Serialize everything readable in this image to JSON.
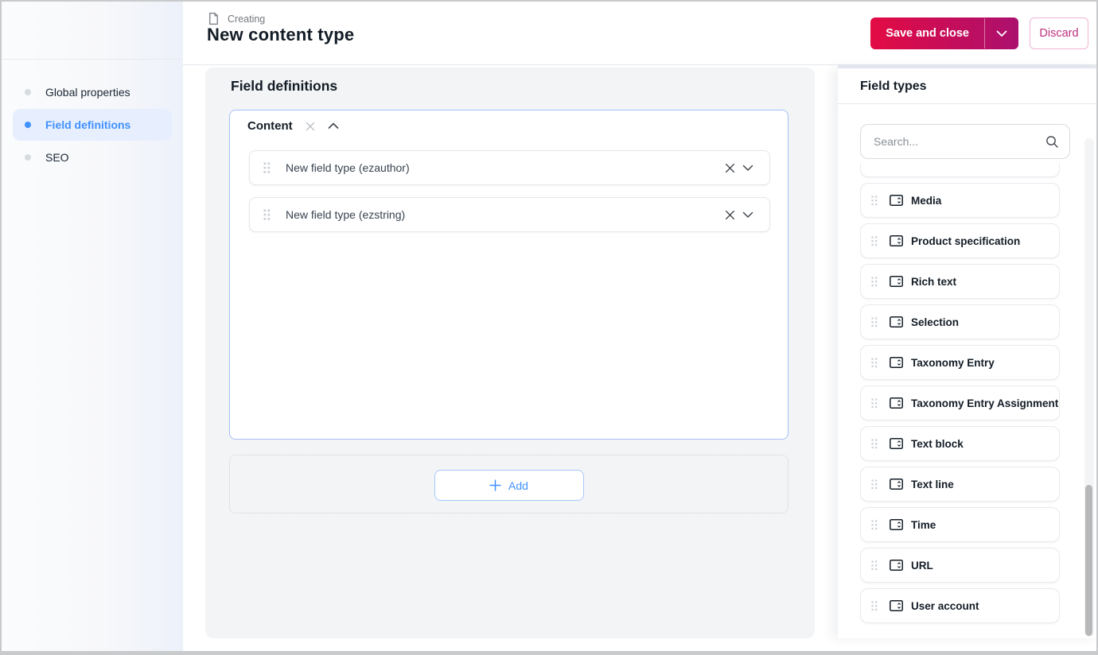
{
  "header": {
    "breadcrumb": "Creating",
    "title": "New content type",
    "save_button": "Save and close",
    "discard_button": "Discard"
  },
  "sidebar": {
    "items": [
      {
        "label": "Global properties",
        "active": false
      },
      {
        "label": "Field definitions",
        "active": true
      },
      {
        "label": "SEO",
        "active": false
      }
    ]
  },
  "main": {
    "heading": "Field definitions",
    "group": {
      "title": "Content",
      "fields": [
        {
          "label": "New field type (ezauthor)"
        },
        {
          "label": "New field type (ezstring)"
        }
      ]
    },
    "add_button": "Add"
  },
  "field_types_panel": {
    "title": "Field types",
    "search_placeholder": "Search...",
    "items": [
      "Media",
      "Product specification",
      "Rich text",
      "Selection",
      "Taxonomy Entry",
      "Taxonomy Entry Assignment",
      "Text block",
      "Text line",
      "Time",
      "URL",
      "User account"
    ]
  },
  "icons": {
    "document": "document-icon",
    "close": "close-icon",
    "chevron_up": "chevron-up-icon",
    "chevron_down": "chevron-down-icon",
    "drag_handle": "drag-handle-icon",
    "plus": "plus-icon",
    "search": "search-icon",
    "field_type": "field-type-icon"
  },
  "colors": {
    "accent_blue": "#4191ff",
    "accent_blue_bg": "#e7efff",
    "primary_gradient_start": "#e30b44",
    "primary_gradient_end": "#ab106e",
    "discard_text": "#bd2f7f",
    "panel_bg": "#f3f4f6",
    "text_dark": "#131c26",
    "group_border": "#a6c0f7"
  }
}
